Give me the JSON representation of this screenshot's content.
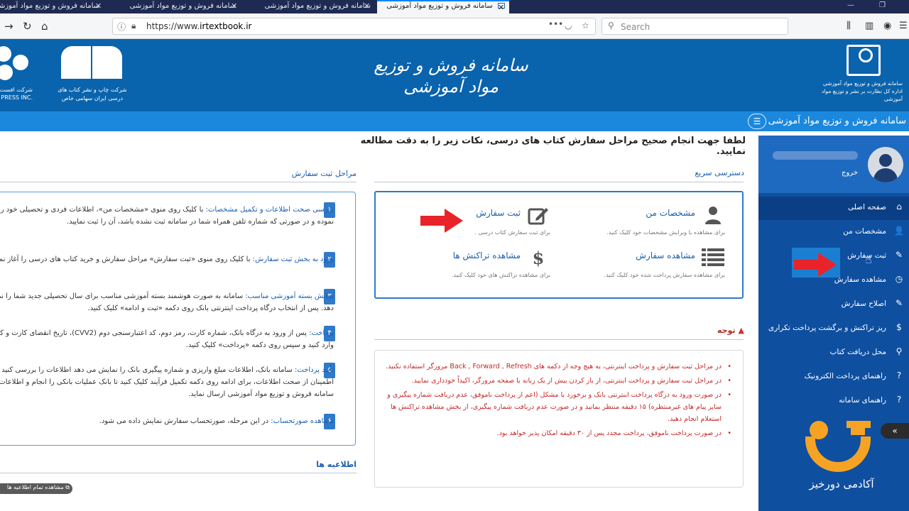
{
  "browser": {
    "tabs": [
      {
        "label": "سامانه فروش و توزیع مواد آموزشی",
        "close": "✕"
      },
      {
        "label": "سامانه فروش و توزیع مواد آموزشی",
        "close": "✕"
      },
      {
        "label": "سامانه فروش و توزیع مواد آموزشی",
        "close": "✕"
      },
      {
        "label": "سامانه فروش و توزیع مواد آموزشی",
        "close": "✕"
      }
    ],
    "url_prefix": "https://www.",
    "url_domain": "irtextbook.ir",
    "search_placeholder": "Search",
    "more": "•••"
  },
  "header": {
    "site_title": "سامانه فروش و توزیع مواد آموزشی",
    "emblem_caption": "سامانه فروش و توزیع مواد آموزشی اداره کل نظارت بر نشر و توزیع مواد آموزشی",
    "book_logo_caption": "شرکت چاپ و نشر کتاب های درسی ایران سهامی خاص",
    "corner_logo_caption": "شرکت افست سهامی عام",
    "corner_logo_caption_en": "OFFSET PRESS INC."
  },
  "title_bar": {
    "title": "سامانه فروش و توزیع مواد آموزشی",
    "menu_icon": "☰"
  },
  "sidebar": {
    "logout": "خروج",
    "items": [
      {
        "label": "صفحه اصلی",
        "icon": "⌂"
      },
      {
        "label": "مشخصات من",
        "icon": "👤"
      },
      {
        "label": "ثبت سفارش",
        "icon": "✎"
      },
      {
        "label": "مشاهده سفارش",
        "icon": "◷"
      },
      {
        "label": "اصلاح سفارش",
        "icon": "✎"
      },
      {
        "label": "ریز تراکنش و برگشت پرداخت تکراری",
        "icon": "$"
      },
      {
        "label": "محل دریافت کتاب",
        "icon": "⚲"
      },
      {
        "label": "راهنمای پرداخت الکترونیک",
        "icon": "?"
      },
      {
        "label": "راهنمای سامانه",
        "icon": "?"
      }
    ]
  },
  "main": {
    "notice": "لطفا جهت انجام صحیح مراحل سفارش کتاب های درسی، نکات زیر را به دقت مطالعه نمایید.",
    "quick_access_title": "دسترسی سریع",
    "steps_title": "مراحل ثبت سفارش",
    "quick_actions": [
      {
        "title": "مشخصات من",
        "desc": "برای مشاهده یا ویرایش مشخصات خود کلیک کنید."
      },
      {
        "title": "ثبت سفارش",
        "desc": "برای ثبت سفارش کتاب درسی ."
      },
      {
        "title": "مشاهده سفارش",
        "desc": "برای مشاهده سفارش پرداخت شده خود کلیک کنید."
      },
      {
        "title": "مشاهده تراکنش ها",
        "desc": "برای مشاهده تراکنش های خود کلیک کنید."
      }
    ],
    "alert_title": "توجه",
    "alerts": [
      "در مراحل ثبت سفارش و پرداخت اینترنتی، به هیچ وجه از دکمه های Back , Forward , Refresh مرورگر استفاده نکنید.",
      "در مراحل ثبت سفارش و پرداخت اینترنتی، از باز کردن بیش از یک زبانه یا صفحه مرورگر، اکیداً خودداری نمایید.",
      "در صورت ورود به درگاه پرداخت اینترنتی بانک و برخورد با مشکل (اعم از پرداخت ناموفق، عدم دریافت شماره پیگیری و سایر پیام های غیرمنتظره) ۱۵ دقیقه منتظر بمانید و در صورت عدم دریافت شماره پیگیری، از بخش مشاهده تراکنش ها استعلام انجام دهید.",
      "در صورت پرداخت ناموفق، پرداخت مجدد پس از ۳۰ دقیقه امکان پذیر خواهد بود."
    ],
    "steps": [
      {
        "num": "۱",
        "head": "بررسی صحت اطلاعات و تکمیل مشخصات:",
        "body": " با کلیک روی منوی «مشخصات من»، اطلاعات فردی و تحصیلی خود را مشاهده نموده و در صورتی که شماره تلفن همراه شما در سامانه ثبت نشده باشد، آن را ثبت نمایید."
      },
      {
        "num": "۲",
        "head": "ورود به بخش ثبت سفارش:",
        "body": " با کلیک روی منوی «ثبت سفارش» مراحل سفارش و خرید کتاب های درسی را آغاز نمایید."
      },
      {
        "num": "۳",
        "head": "نمایش بسته آموزشی مناسب:",
        "body": " سامانه به صورت هوشمند بسته آموزشی مناسب برای سال تحصیلی جدید شما را نمایش می دهد. پس از انتخاب درگاه پرداخت اینترنتی بانک روی دکمه «ثبت و ادامه» کلیک کنید."
      },
      {
        "num": "۴",
        "head": "پرداخت:",
        "body": " پس از ورود به درگاه بانک، شماره کارت، رمز دوم، کد اعتبارسنجی دوم (CVV2)، تاریخ انقضای کارت و کد امنیتی را وارد کنید و سپس روی دکمه «پرداخت» کلیک کنید."
      },
      {
        "num": "۵",
        "head": "تأیید پرداخت:",
        "body": " سامانه بانک، اطلاعات مبلغ واریزی و شماره پیگیری بانک را نمایش می دهد اطلاعات را بررسی کنید در صورت اطمینان از صحت اطلاعات، برای ادامه روی دکمه تکمیل فرآیند کلیک کنید تا بانک عملیات بانکی را انجام و اطلاعات آن را به سامانه فروش و توزیع مواد آموزشی ارسال نماید."
      },
      {
        "num": "۶",
        "head": "مشاهده صورتحساب:",
        "body": " در این مرحله، صورتحساب سفارش نمایش داده می شود."
      }
    ],
    "news_title": "اطلاعیه ها",
    "view_all": "مشاهده تمام اطلاعیه ها"
  },
  "overlay": {
    "academy_name": "آکادمی دورخیز",
    "collapse": "«",
    "arrow_color": "#e8232a"
  }
}
